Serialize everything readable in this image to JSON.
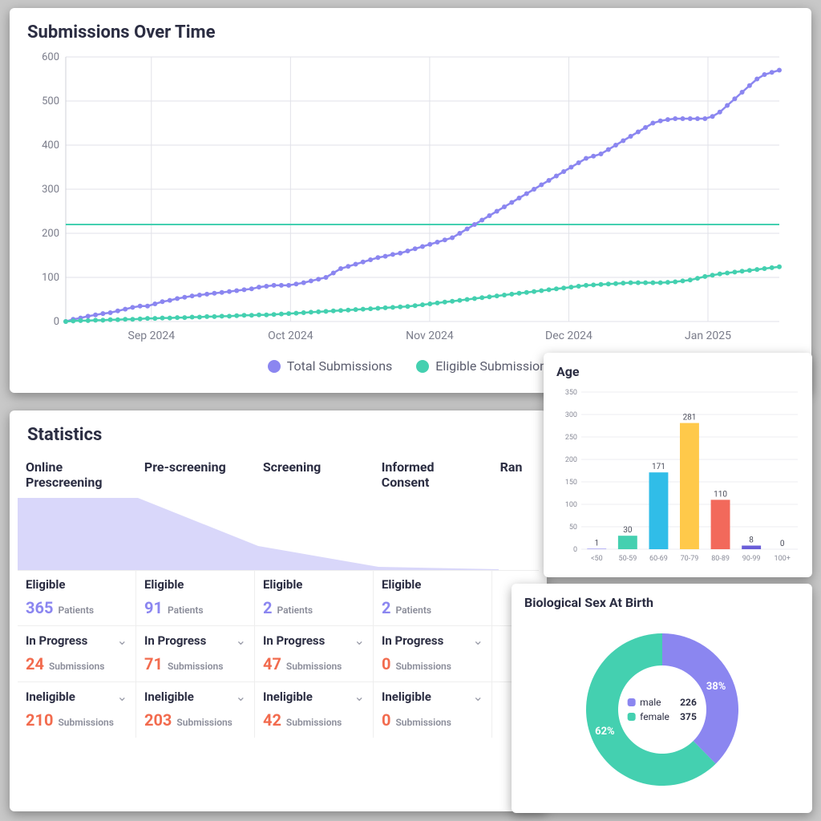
{
  "colors": {
    "purple": "#8b86f0",
    "teal": "#44d0b0",
    "orange": "#f26b4e",
    "blue": "#30bde8",
    "yellow": "#ffc94a",
    "red": "#f2695b",
    "darkpurple": "#6a5ed8"
  },
  "line_chart": {
    "title": "Submissions Over Time",
    "legend": {
      "total": "Total Submissions",
      "eligible": "Eligible Submissions"
    }
  },
  "stats": {
    "title": "Statistics",
    "stages": [
      {
        "name": "Online Prescreening",
        "eligible": 365,
        "in_progress": 24,
        "ineligible": 210
      },
      {
        "name": "Pre-screening",
        "eligible": 91,
        "in_progress": 71,
        "ineligible": 203
      },
      {
        "name": "Screening",
        "eligible": 2,
        "in_progress": 47,
        "ineligible": 42
      },
      {
        "name": "Informed Consent",
        "eligible": 2,
        "in_progress": 0,
        "ineligible": 0
      },
      {
        "name": "Ran"
      }
    ],
    "labels": {
      "eligible": "Eligible",
      "in_progress": "In Progress",
      "ineligible": "Ineligible",
      "patients": "Patients",
      "submissions": "Submissions"
    }
  },
  "age_chart": {
    "title": "Age"
  },
  "sex_chart": {
    "title": "Biological Sex At Birth",
    "male_label": "male",
    "female_label": "female",
    "male_count": "226",
    "female_count": "375",
    "male_pct": "38%",
    "female_pct": "62%"
  },
  "chart_data": [
    {
      "type": "line",
      "title": "Submissions Over Time",
      "xlabel": "",
      "ylabel": "",
      "ylim": [
        0,
        600
      ],
      "y_ticks": [
        0,
        100,
        200,
        300,
        400,
        500,
        600
      ],
      "x_ticks": [
        "Sep 2024",
        "Oct 2024",
        "Nov 2024",
        "Dec 2024",
        "Jan 2025"
      ],
      "hline": 220,
      "series": [
        {
          "name": "Total Submissions",
          "color": "#8b86f0",
          "values": [
            0,
            5,
            8,
            12,
            15,
            18,
            20,
            24,
            28,
            32,
            35,
            35,
            40,
            45,
            48,
            52,
            55,
            58,
            60,
            62,
            64,
            66,
            68,
            70,
            72,
            74,
            78,
            80,
            82,
            82,
            82,
            85,
            88,
            92,
            96,
            100,
            110,
            120,
            125,
            130,
            135,
            140,
            145,
            148,
            152,
            155,
            160,
            165,
            170,
            175,
            180,
            185,
            190,
            200,
            210,
            220,
            230,
            240,
            250,
            260,
            270,
            280,
            290,
            300,
            310,
            320,
            330,
            340,
            350,
            360,
            370,
            375,
            380,
            390,
            400,
            410,
            420,
            430,
            440,
            450,
            455,
            458,
            460,
            460,
            460,
            460,
            460,
            465,
            475,
            490,
            505,
            520,
            535,
            550,
            560,
            565,
            570
          ]
        },
        {
          "name": "Eligible Submissions",
          "color": "#44d0b0",
          "values": [
            0,
            1,
            2,
            2,
            3,
            3,
            4,
            4,
            5,
            5,
            6,
            7,
            7,
            8,
            8,
            9,
            9,
            10,
            10,
            11,
            11,
            12,
            12,
            13,
            14,
            14,
            15,
            15,
            16,
            17,
            18,
            19,
            20,
            21,
            22,
            23,
            24,
            25,
            26,
            27,
            28,
            29,
            30,
            31,
            32,
            33,
            34,
            36,
            38,
            40,
            42,
            44,
            46,
            48,
            50,
            52,
            54,
            56,
            58,
            60,
            62,
            64,
            66,
            68,
            70,
            72,
            74,
            76,
            78,
            80,
            82,
            83,
            84,
            85,
            86,
            87,
            88,
            88,
            88,
            88,
            88,
            89,
            90,
            92,
            94,
            98,
            102,
            105,
            108,
            110,
            112,
            114,
            116,
            118,
            120,
            122,
            124
          ]
        }
      ]
    },
    {
      "type": "bar",
      "title": "Age",
      "categories": [
        "<50",
        "50-59",
        "60-69",
        "70-79",
        "80-89",
        "90-99",
        "100+"
      ],
      "values": [
        1,
        30,
        171,
        281,
        110,
        8,
        0
      ],
      "colors": [
        "#8b86f0",
        "#44d0b0",
        "#30bde8",
        "#ffc94a",
        "#f2695b",
        "#6a5ed8",
        "#8b86f0"
      ],
      "ylim": [
        0,
        350
      ],
      "y_ticks": [
        0,
        50,
        100,
        150,
        200,
        250,
        300,
        350
      ],
      "xlabel": "",
      "ylabel": ""
    },
    {
      "type": "pie",
      "title": "Biological Sex At Birth",
      "series": [
        {
          "name": "male",
          "value": 226,
          "pct": 38,
          "color": "#8b86f0"
        },
        {
          "name": "female",
          "value": 375,
          "pct": 62,
          "color": "#44d0b0"
        }
      ]
    }
  ]
}
